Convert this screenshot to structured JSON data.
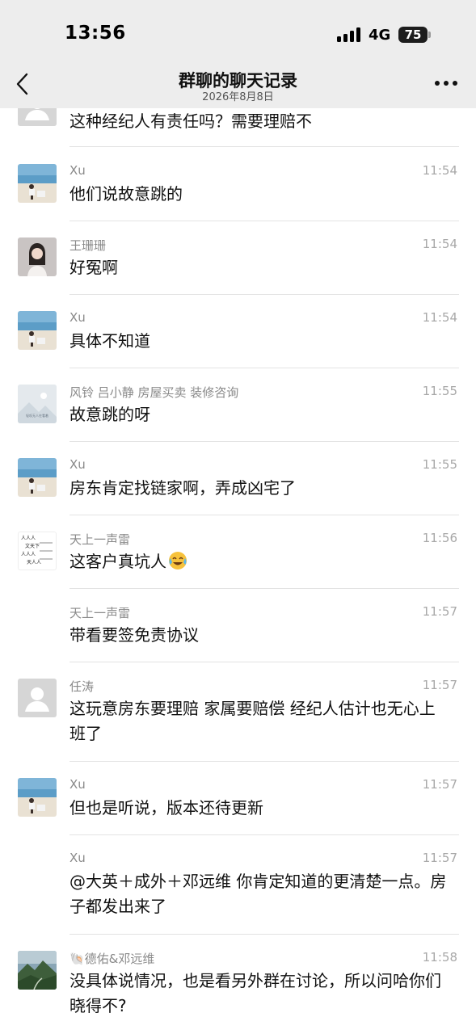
{
  "status_bar": {
    "time": "13:56",
    "network": "4G",
    "battery": "75"
  },
  "header": {
    "title": "群聊的聊天记录",
    "date": "2026年8月8日"
  },
  "messages": [
    {
      "sender": "",
      "time": "",
      "text": "这种经纪人有责任吗？需要理赔不",
      "avatar": "default-avatar"
    },
    {
      "sender": "Xu",
      "time": "11:54",
      "text": "他们说故意跳的",
      "avatar": "beach-photo-avatar"
    },
    {
      "sender": "王珊珊",
      "time": "11:54",
      "text": "好冤啊",
      "avatar": "portrait-photo-avatar"
    },
    {
      "sender": "Xu",
      "time": "11:54",
      "text": "具体不知道",
      "avatar": "beach-photo-avatar"
    },
    {
      "sender": "风铃 吕小静 房屋买卖  装修咨询",
      "time": "11:55",
      "text": "故意跳的呀",
      "avatar": "landscape-placeholder-avatar",
      "avatar_caption": "轻叹无人在看着"
    },
    {
      "sender": "Xu",
      "time": "11:55",
      "text": "房东肯定找链家啊，弄成凶宅了",
      "avatar": "beach-photo-avatar"
    },
    {
      "sender": "天上一声雷",
      "time": "11:56",
      "text": "这客户真坑人",
      "avatar": "figures-chart-avatar",
      "emoji": "laughing-crying-emoji"
    },
    {
      "sender": "天上一声雷",
      "time": "11:57",
      "text": "带看要签免责协议",
      "avatar": ""
    },
    {
      "sender": "任涛",
      "time": "11:57",
      "text": "这玩意房东要理赔 家属要赔偿  经纪人估计也无心上班了",
      "avatar": "default-avatar"
    },
    {
      "sender": "Xu",
      "time": "11:57",
      "text": "但也是听说，版本还待更新",
      "avatar": "beach-photo-avatar"
    },
    {
      "sender": "Xu",
      "time": "11:57",
      "text": "@大英＋成外＋邓远维 你肯定知道的更清楚一点。房子都发出来了",
      "avatar": ""
    },
    {
      "sender": "🐚德佑&邓远维",
      "time": "11:58",
      "text": "没具体说情况，也是看另外群在讨论，所以问哈你们晓得不?",
      "avatar": "mountain-photo-avatar"
    }
  ],
  "colors": {
    "header_bg": "#ededed",
    "page_bg": "#ffffff",
    "sender_text": "#8a8a8a",
    "time_text": "#a8a8a8",
    "divider": "#e3e3e3"
  }
}
